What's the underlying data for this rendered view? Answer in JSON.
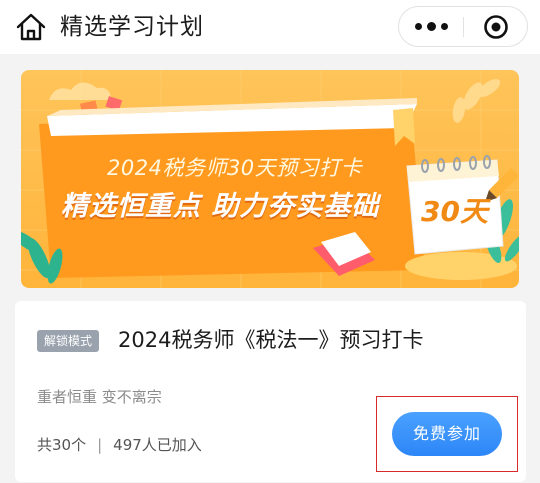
{
  "header": {
    "title": "精选学习计划",
    "icons": {
      "home": "home-icon",
      "more": "more-dots-icon",
      "close": "close-circle-icon"
    }
  },
  "banner": {
    "subtitle": "2024税务师30天预习打卡",
    "headline": "精选恒重点 助力夯实基础",
    "calendar_days": "30天"
  },
  "card": {
    "mode_badge": "解锁模式",
    "title": "2024税务师《税法一》预习打卡",
    "slogan": "重者恒重 变不离宗",
    "count": "共30个",
    "divider": "|",
    "joined": "497人已加入",
    "join_button": "免费参加"
  },
  "colors": {
    "accent_blue": "#2d86f7",
    "banner_orange": "#ffb43a",
    "highlight_red": "#d92b2b",
    "badge_grey": "#9aa2ad"
  }
}
